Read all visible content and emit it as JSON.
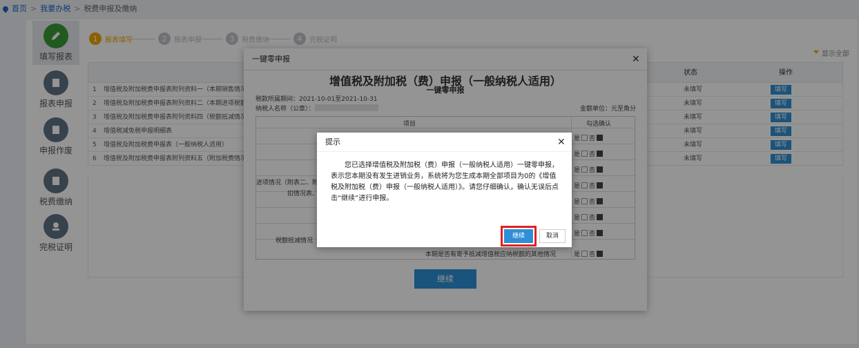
{
  "breadcrumb": {
    "items": [
      "首页",
      "我要办税",
      "税费申报及缴纳"
    ],
    "sep": ">"
  },
  "sidebar": {
    "items": [
      {
        "label": "填写报表",
        "icon": "pencil-icon"
      },
      {
        "label": "报表申报",
        "icon": "report-icon"
      },
      {
        "label": "申报作废",
        "icon": "void-icon"
      },
      {
        "label": "税费缴纳",
        "icon": "pay-icon"
      },
      {
        "label": "完税证明",
        "icon": "certificate-icon"
      }
    ]
  },
  "steps": [
    {
      "num": "1",
      "label": "报表填写"
    },
    {
      "num": "2",
      "label": "报表申报"
    },
    {
      "num": "3",
      "label": "税费缴纳"
    },
    {
      "num": "4",
      "label": "完税证明"
    }
  ],
  "show_all": "显示全部",
  "table": {
    "headers": {
      "status": "状态",
      "action": "操作"
    },
    "rows": [
      {
        "num": "1",
        "name": "增值税及附加税费申报表附列资料一（本期销售情况明细）",
        "status": "未填写",
        "action": "填写"
      },
      {
        "num": "2",
        "name": "增值税及附加税费申报表附列资料二（本期进项税额明细）",
        "status": "未填写",
        "action": "填写"
      },
      {
        "num": "3",
        "name": "增值税及附加税费申报表附列资料四（税额抵减情况表）",
        "status": "未填写",
        "action": "填写"
      },
      {
        "num": "4",
        "name": "增值税减免税申报明细表",
        "status": "未填写",
        "action": "填写"
      },
      {
        "num": "5",
        "name": "增值税及附加税费申报表（一般纳税人适用）",
        "status": "未填写",
        "action": "填写"
      },
      {
        "num": "6",
        "name": "增值税及附加税费申报表附列资料五（附加税费情况表）",
        "status": "未填写",
        "action": "填写"
      }
    ]
  },
  "dialog1": {
    "title": "一键零申报",
    "heading": "增值税及附加税（费）申报（一般纳税人适用）",
    "subheading": "一键零申报",
    "period": "税款所属期间：2021-10-01至2021-10-31",
    "taxpayer": "纳税人名称（公章）：",
    "unit": "金额单位：元至角分",
    "col_item": "项目",
    "col_confirm": "勾选确认",
    "label_input": "进项情况（附表二、附",
    "label_deduct": "扣情况表、",
    "label_reduce": "税额抵减情况（附",
    "last_row": "本期是否有寄予抵减增值税应纳税额的其他情况",
    "yes": "是",
    "no": "否",
    "continue": "继续"
  },
  "dialog2": {
    "title": "提示",
    "message": "您已选择增值税及附加税（费）申报（一般纳税人适用）一键零申报，表示您本期没有发生进销业务，系统将为您生成本期全部项目为0的《增值税及附加税（费）申报（一般纳税人适用）》。请您仔细确认，确认无误后点击“继续”进行申报。",
    "ok": "继续",
    "cancel": "取消"
  },
  "colors": {
    "primary": "#2e8fd6",
    "active_step": "#f0a800",
    "highlight": "#e02020",
    "green": "#3c9a38"
  }
}
